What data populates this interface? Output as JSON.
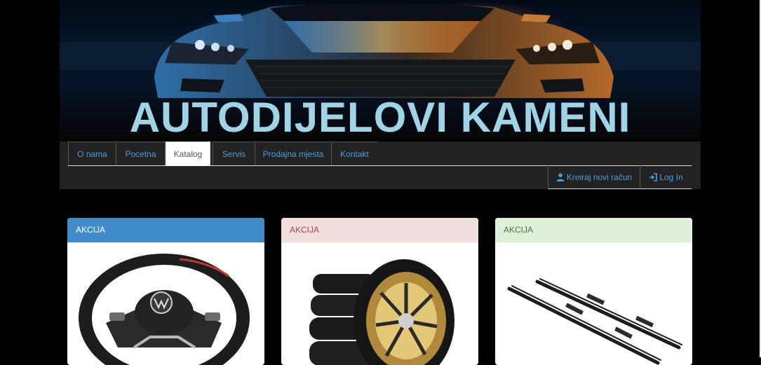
{
  "header": {
    "title": "AUTODIJELOVI KAMENI"
  },
  "nav": {
    "tabs": [
      {
        "label": "O nama",
        "active": false
      },
      {
        "label": "Pocetna",
        "active": false
      },
      {
        "label": "Katalog",
        "active": true
      },
      {
        "label": "Servis",
        "active": false
      },
      {
        "label": "Prodajna mjesta",
        "active": false
      },
      {
        "label": "Kontakt",
        "active": false
      }
    ],
    "register_label": "Kreiraj novi račun",
    "login_label": "Log In",
    "register_icon": "user-icon",
    "login_icon": "log-in-icon"
  },
  "products": [
    {
      "badge": "AKCIJA",
      "style": "primary",
      "image": "steering-wheel"
    },
    {
      "badge": "AKCIJA",
      "style": "danger",
      "image": "tires-gold-rim"
    },
    {
      "badge": "AKCIJA",
      "style": "success",
      "image": "wiper-blades"
    }
  ],
  "colors": {
    "link": "#4a9fe0",
    "navbar": "#222222",
    "title": "#9fd3e6",
    "primary": "#428bca",
    "danger_bg": "#f2dede",
    "success_bg": "#dff0d8"
  }
}
